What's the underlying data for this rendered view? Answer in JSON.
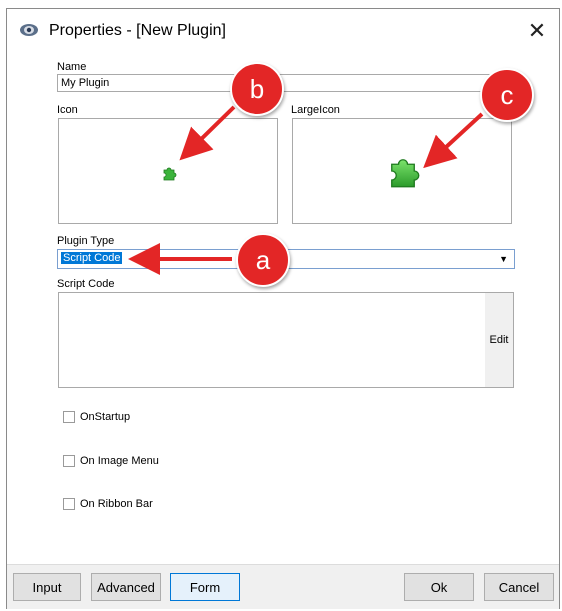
{
  "window": {
    "title": "Properties - [New Plugin]"
  },
  "form": {
    "name_label": "Name",
    "name_value": "My Plugin",
    "icon_label": "Icon",
    "large_icon_label": "LargeIcon",
    "plugin_type_label": "Plugin Type",
    "plugin_type_value": "Script Code",
    "script_code_label": "Script Code",
    "edit_label": "Edit",
    "checkboxes": [
      "OnStartup",
      "On Image Menu",
      "On Ribbon Bar"
    ]
  },
  "buttons": {
    "input": "Input",
    "advanced": "Advanced",
    "form": "Form",
    "ok": "Ok",
    "cancel": "Cancel"
  },
  "callouts": {
    "a": "a",
    "b": "b",
    "c": "c"
  },
  "colors": {
    "accent": "#0078d7",
    "callout": "#e32626",
    "puzzle": "#3cb43c"
  },
  "icons": [
    "app-eye-icon",
    "close-icon",
    "puzzle-small-icon",
    "puzzle-large-icon",
    "dropdown-arrow-icon"
  ]
}
